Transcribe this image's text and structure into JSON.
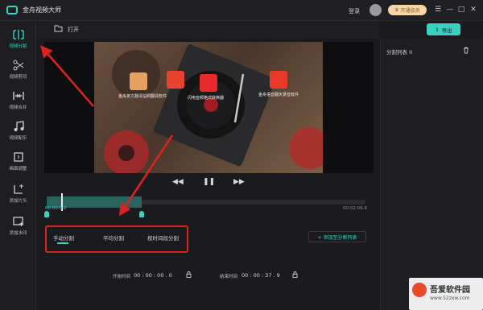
{
  "app": {
    "title": "金舟视频大师"
  },
  "titlebar": {
    "login": "登录",
    "vip_label": "开通会员",
    "min": "—",
    "max": "□",
    "close": "✕",
    "menu": "☰"
  },
  "toolbar": {
    "open_label": "打开",
    "export_label": "导出"
  },
  "sidebar": {
    "items": [
      {
        "label": "视频分割",
        "icon": "scissors-icon",
        "active": true
      },
      {
        "label": "视频剪切",
        "icon": "cut-icon"
      },
      {
        "label": "视频合并",
        "icon": "merge-icon"
      },
      {
        "label": "视频配乐",
        "icon": "music-note-icon"
      },
      {
        "label": "画面调整",
        "icon": "crop-icon"
      },
      {
        "label": "添加片头",
        "icon": "add-intro-icon"
      },
      {
        "label": "添加水印",
        "icon": "watermark-icon"
      }
    ]
  },
  "video_overlay": {
    "app1": "金舟英文翻译拍照翻译软件",
    "app2": "闪电音频格式转换器",
    "app3": "金舟语音翻天录音软件"
  },
  "player": {
    "prev": "◀◀",
    "pause": "❚❚",
    "next": "▶▶"
  },
  "timeline": {
    "start_tc": "00:00:0.2",
    "end_tc": "00:02:06.6",
    "selection_fraction": 0.3
  },
  "split_modes": {
    "manual": "手动分割",
    "average": "平均分割",
    "by_time": "按时间段分割",
    "add_to_list": "+ 添加至分割列表"
  },
  "time_fields": {
    "start_label": "开始时间",
    "start_value": "00 : 00 : 00 . 0",
    "end_label": "结束时间",
    "end_value": "00 : 00 : 37 . 9"
  },
  "right_panel": {
    "list_title": "分割列表 0"
  },
  "watermark": {
    "text": "吾爱软件园",
    "url": "www.52zxw.com"
  },
  "colors": {
    "accent": "#3ad0c0",
    "annotation": "#e02020"
  }
}
